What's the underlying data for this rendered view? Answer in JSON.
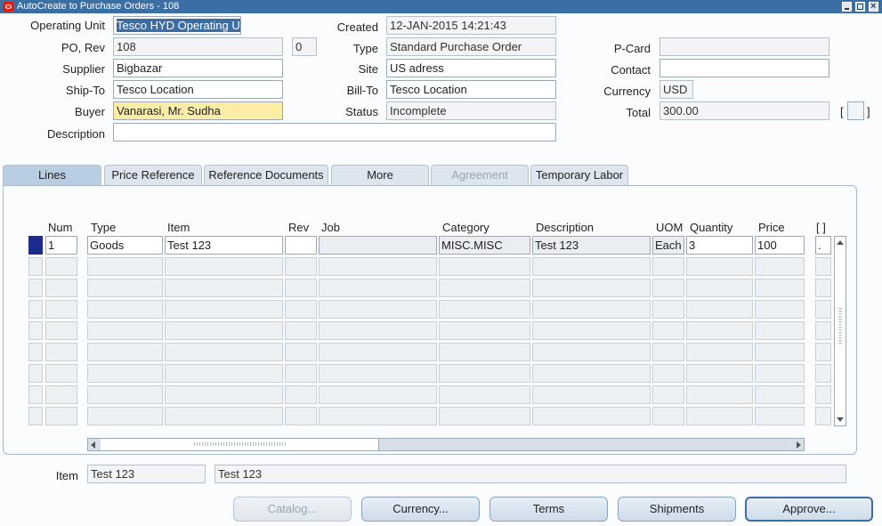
{
  "window": {
    "title": "AutoCreate to Purchase Orders - 108"
  },
  "header": {
    "operating_unit": {
      "label": "Operating Unit",
      "value": "Tesco HYD Operating U"
    },
    "po_rev": {
      "label": "PO, Rev",
      "po": "108",
      "rev": "0"
    },
    "supplier": {
      "label": "Supplier",
      "value": "Bigbazar"
    },
    "ship_to": {
      "label": "Ship-To",
      "value": "Tesco Location"
    },
    "buyer": {
      "label": "Buyer",
      "value": "Vanarasi, Mr. Sudha"
    },
    "description": {
      "label": "Description",
      "value": ""
    },
    "created": {
      "label": "Created",
      "value": "12-JAN-2015 14:21:43"
    },
    "type": {
      "label": "Type",
      "value": "Standard Purchase Order"
    },
    "site": {
      "label": "Site",
      "value": "US adress"
    },
    "bill_to": {
      "label": "Bill-To",
      "value": "Tesco Location"
    },
    "status": {
      "label": "Status",
      "value": "Incomplete"
    },
    "p_card": {
      "label": "P-Card",
      "value": ""
    },
    "contact": {
      "label": "Contact",
      "value": ""
    },
    "currency": {
      "label": "Currency",
      "value": "USD"
    },
    "total": {
      "label": "Total",
      "value": "300.00"
    },
    "descriptive_flex": {
      "open": "[",
      "close": "]"
    }
  },
  "tabs": [
    {
      "label": "Lines",
      "state": "active"
    },
    {
      "label": "Price Reference",
      "state": "normal"
    },
    {
      "label": "Reference Documents",
      "state": "normal"
    },
    {
      "label": "More",
      "state": "normal"
    },
    {
      "label": "Agreement",
      "state": "disabled"
    },
    {
      "label": "Temporary Labor",
      "state": "normal"
    }
  ],
  "lines": {
    "columns": {
      "num": "Num",
      "type": "Type",
      "item": "Item",
      "rev": "Rev",
      "job": "Job",
      "category": "Category",
      "description": "Description",
      "uom": "UOM",
      "quantity": "Quantity",
      "price": "Price",
      "flex": "[ ]"
    },
    "rows": [
      {
        "num": "1",
        "type": "Goods",
        "item": "Test 123",
        "rev": "",
        "job": "",
        "category": "MISC.MISC",
        "description": "Test 123",
        "uom": "Each",
        "quantity": "3",
        "price": "100",
        "flex": "."
      }
    ],
    "empty_rows": 8
  },
  "footer": {
    "item_label": "Item",
    "item_value": "Test 123",
    "item_description": "Test 123"
  },
  "buttons": {
    "catalog": "Catalog...",
    "currency": "Currency...",
    "terms": "Terms",
    "shipments": "Shipments",
    "approve": "Approve..."
  },
  "colors": {
    "titlebar": "#3b6ea5",
    "required_field": "#fbeda6",
    "current_record": "#1d2b8c",
    "active_tab": "#b9cde3"
  }
}
